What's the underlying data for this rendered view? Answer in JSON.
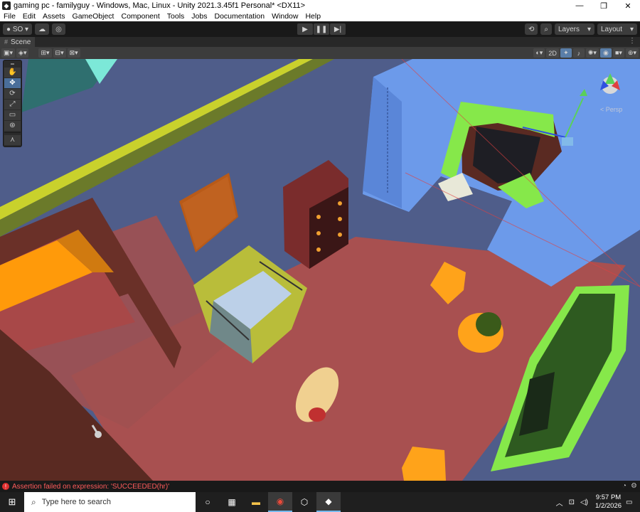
{
  "window": {
    "title": "gaming pc - familyguy - Windows, Mac, Linux - Unity 2021.3.45f1 Personal* <DX11>",
    "minimize": "—",
    "maximize": "❐",
    "close": "✕"
  },
  "menu": [
    "File",
    "Edit",
    "Assets",
    "GameObject",
    "Component",
    "Tools",
    "Jobs",
    "Documentation",
    "Window",
    "Help"
  ],
  "toolbar": {
    "account": "SO",
    "layers_label": "Layers",
    "layout_label": "Layout"
  },
  "scene_tab": {
    "label": "Scene"
  },
  "scene_toolbar": {
    "mode_2d": "2D"
  },
  "viewport": {
    "persp_label": "< Persp"
  },
  "status": {
    "message": "Assertion failed on expression: 'SUCCEEDED(hr)'"
  },
  "taskbar": {
    "search_placeholder": "Type here to search",
    "time": "9:57 PM",
    "date": "1/2/2026"
  },
  "colors": {
    "floor": "#a85050",
    "walls": "#4f5d8a",
    "accent_blue": "#6c9aea",
    "curtain_green": "#86e84a"
  }
}
